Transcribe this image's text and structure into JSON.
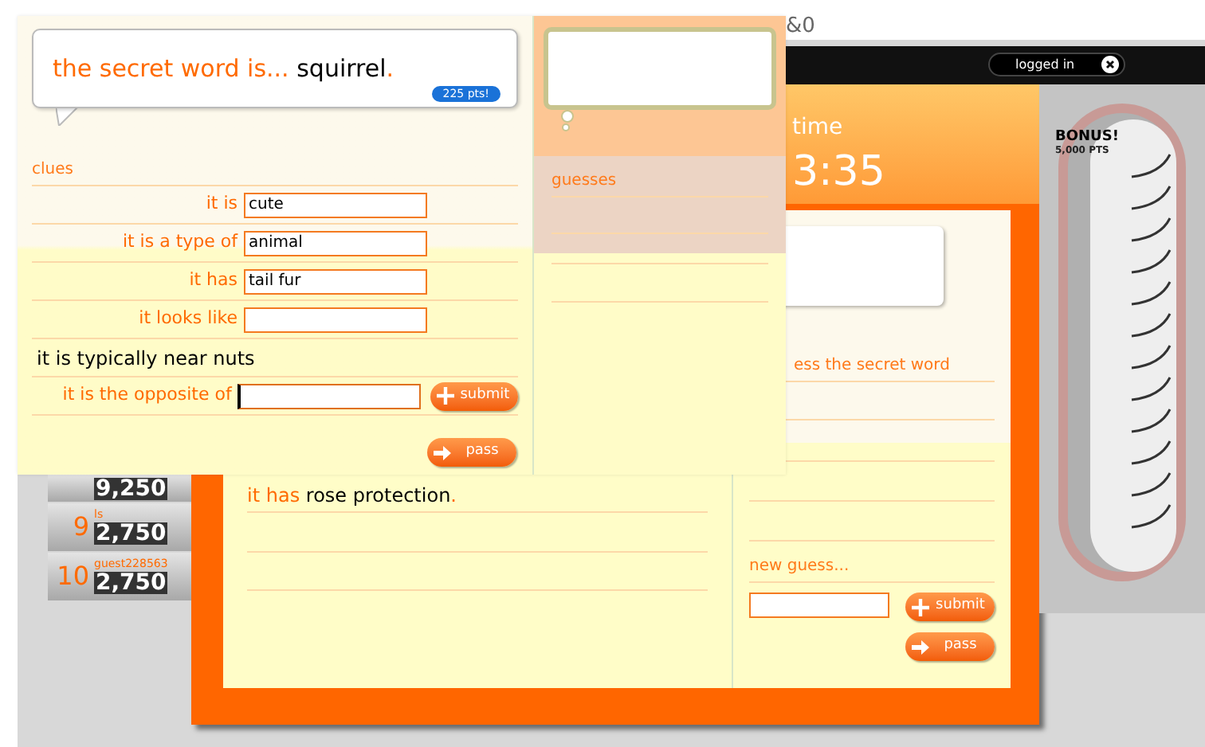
{
  "header": {
    "text": "&0"
  },
  "top_bar": {
    "status": "logged in"
  },
  "timer": {
    "label": "time",
    "value": "3:35"
  },
  "bonus": {
    "title": "BONUS!",
    "points": "5,000 PTS"
  },
  "leaderboard": [
    {
      "score": "9,250"
    },
    {
      "rank": "9",
      "name": "ls",
      "score": "2,750"
    },
    {
      "rank": "10",
      "name": "guest228563",
      "score": "2,750"
    }
  ],
  "game": {
    "prompt": "ess the secret word",
    "clue_lines": [
      {
        "label": "it has",
        "word": "rose protection",
        "end": "."
      }
    ],
    "guess_label": "new guess...",
    "buttons": [
      {
        "kind": "submit",
        "label": "submit"
      },
      {
        "kind": "pass",
        "label": "pass"
      }
    ]
  },
  "overlay": {
    "secret": {
      "lead": "the secret word is...",
      "word": "squirrel",
      "end": ".",
      "points": "225 pts!"
    },
    "clues_heading": "clues",
    "clues": [
      {
        "kind": "field",
        "label": "it is",
        "value": "cute"
      },
      {
        "kind": "field",
        "label": "it is a type of",
        "value": "animal"
      },
      {
        "kind": "field",
        "label": "it has",
        "value": "tail fur"
      },
      {
        "kind": "field",
        "label": "it looks like"
      },
      {
        "kind": "given",
        "text": "it is typically near nuts"
      },
      {
        "kind": "field",
        "label": "it is the opposite of",
        "focused": true,
        "button": "submit"
      }
    ],
    "pass_button": "pass",
    "guesses_heading": "guesses"
  }
}
